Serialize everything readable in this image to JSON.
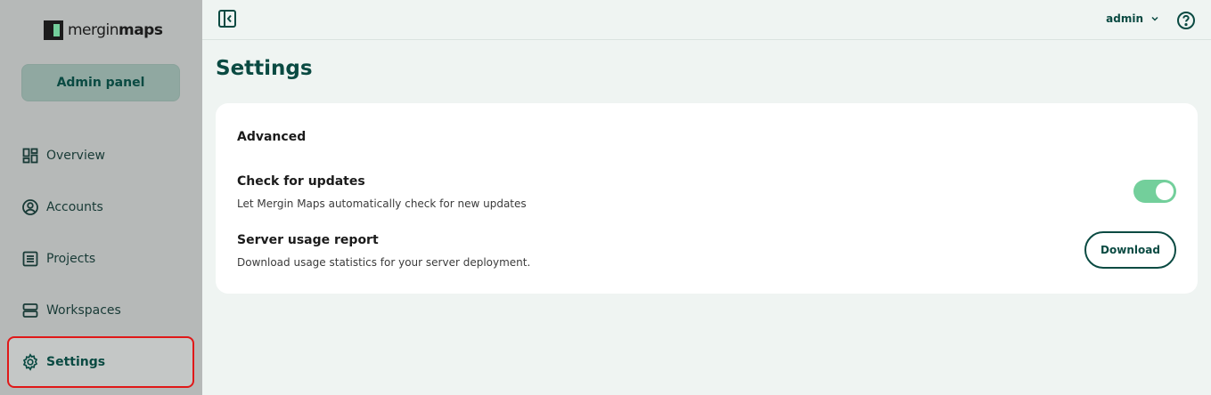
{
  "brand": {
    "name_regular": "mergin",
    "name_bold": "maps"
  },
  "sidebar": {
    "admin_panel_label": "Admin panel",
    "items": [
      {
        "label": "Overview",
        "icon": "dashboard-icon",
        "active": false
      },
      {
        "label": "Accounts",
        "icon": "account-circle-icon",
        "active": false
      },
      {
        "label": "Projects",
        "icon": "list-icon",
        "active": false
      },
      {
        "label": "Workspaces",
        "icon": "server-icon",
        "active": false
      },
      {
        "label": "Settings",
        "icon": "gear-icon",
        "active": true
      }
    ]
  },
  "topbar": {
    "username": "admin"
  },
  "page": {
    "title": "Settings"
  },
  "settings": {
    "section_title": "Advanced",
    "check_updates": {
      "title": "Check for updates",
      "description": "Let Mergin Maps automatically check for new updates",
      "enabled": true
    },
    "usage_report": {
      "title": "Server usage report",
      "description": "Download usage statistics for your server deployment.",
      "button_label": "Download"
    }
  },
  "colors": {
    "accent": "#0a4a42",
    "toggle_on": "#73cf9b",
    "sidebar_bg": "#b6b9b8",
    "highlight_border": "#e01818"
  }
}
